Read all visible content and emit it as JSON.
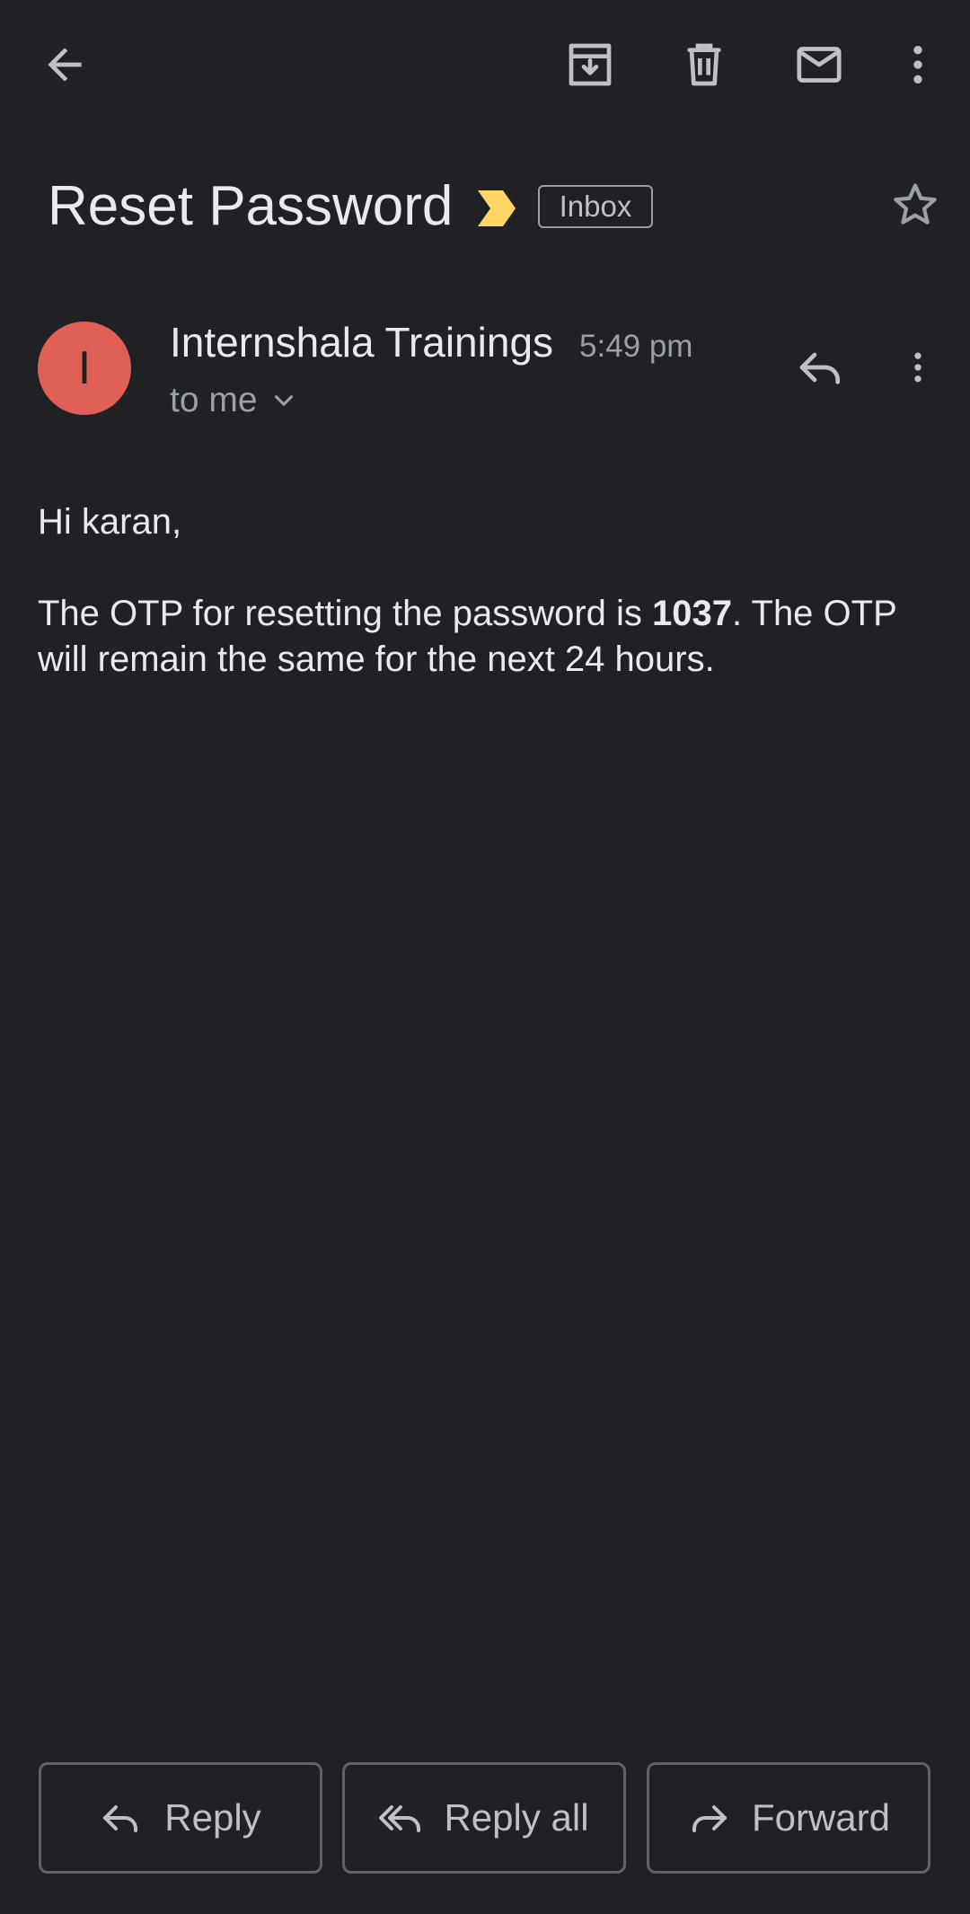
{
  "toolbar": {
    "back_icon": "arrow-back-icon",
    "archive_icon": "archive-icon",
    "delete_icon": "trash-icon",
    "mark_unread_icon": "mail-icon",
    "more_icon": "more-vert-icon"
  },
  "email": {
    "subject": "Reset Password",
    "importance_marker_color": "#fdd663",
    "label": "Inbox",
    "star_icon": "star-outline-icon",
    "sender": {
      "initial": "I",
      "avatar_color": "#e06055",
      "name": "Internshala Trainings",
      "time": "5:49 pm",
      "recipient": "to me"
    },
    "body": {
      "greeting": "Hi karan,",
      "line_prefix": "The OTP for resetting the password is ",
      "otp": "1037",
      "line_suffix": ". The OTP will remain the same for the next 24 hours."
    }
  },
  "actions": {
    "reply_label": "Reply",
    "reply_all_label": "Reply all",
    "forward_label": "Forward"
  }
}
